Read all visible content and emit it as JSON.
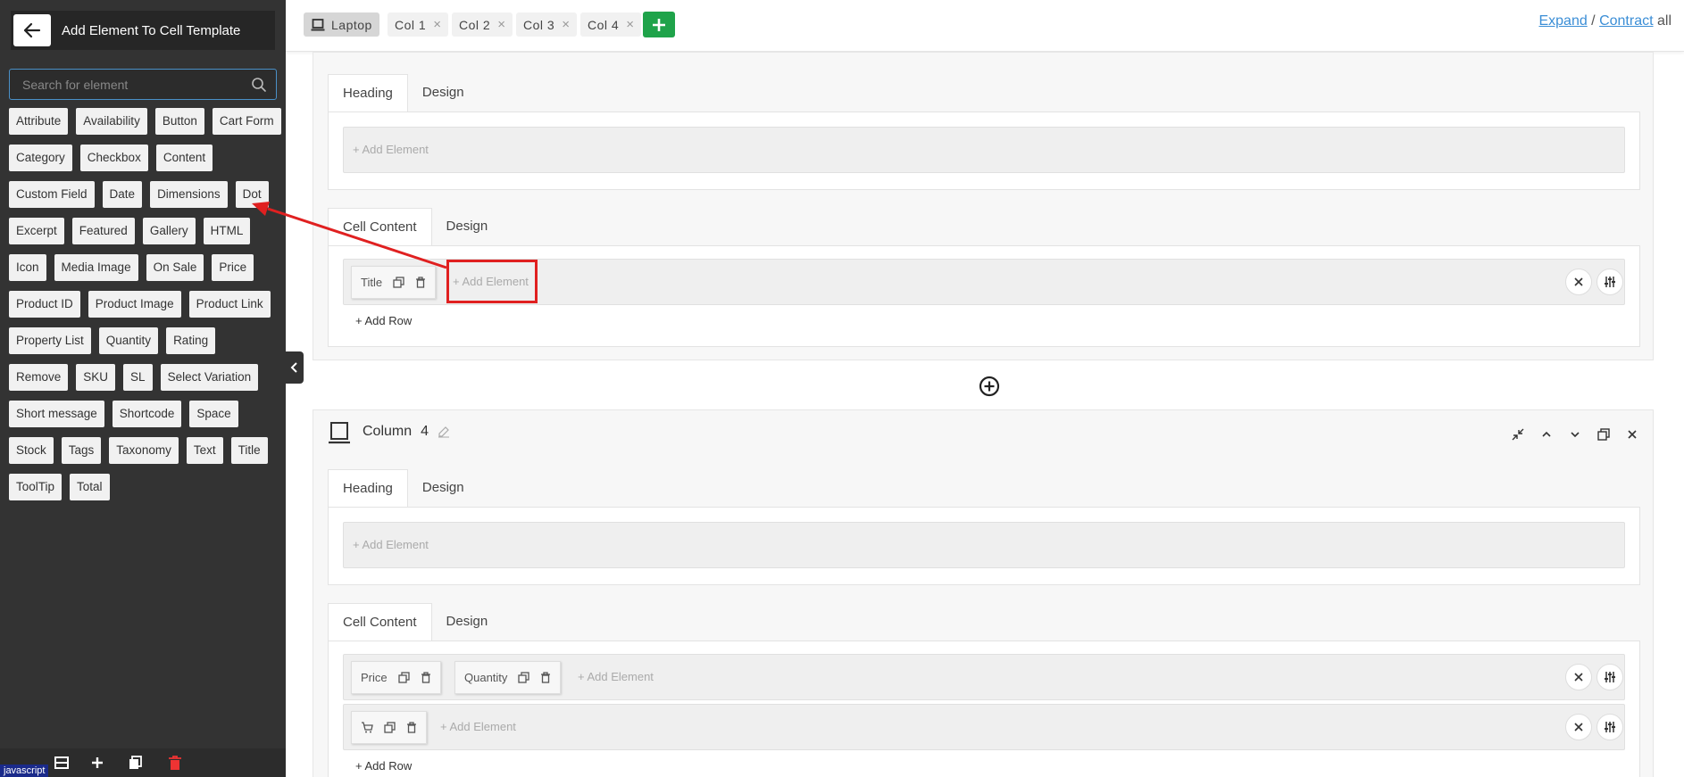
{
  "sidebar": {
    "title": "Add Element To Cell Template",
    "search_placeholder": "Search for element",
    "elements": [
      "Attribute",
      "Availability",
      "Button",
      "Cart Form",
      "Category",
      "Checkbox",
      "Content",
      "Custom Field",
      "Date",
      "Dimensions",
      "Dot",
      "Excerpt",
      "Featured",
      "Gallery",
      "HTML",
      "Icon",
      "Media Image",
      "On Sale",
      "Price",
      "Product ID",
      "Product Image",
      "Product Link",
      "Property List",
      "Quantity",
      "Rating",
      "Remove",
      "SKU",
      "SL",
      "Select Variation",
      "Short message",
      "Shortcode",
      "Space",
      "Stock",
      "Tags",
      "Taxonomy",
      "Text",
      "Title",
      "ToolTip",
      "Total"
    ],
    "footer_badge": "javascript"
  },
  "toolbar": {
    "device_tab": "Laptop",
    "col_tabs": [
      "Col 1",
      "Col 2",
      "Col 3",
      "Col 4"
    ],
    "close_glyph": "×",
    "expand": "Expand",
    "separator": " / ",
    "contract": "Contract",
    "all": " all"
  },
  "column3": {
    "heading_tab": "Heading",
    "design_tab": "Design",
    "heading_add": "+ Add Element",
    "cell_tab": "Cell Content",
    "cell_design_tab": "Design",
    "row1_elements": [
      "Title"
    ],
    "row1_add": "+ Add Element",
    "add_row": "+ Add Row"
  },
  "column4": {
    "title": "Column",
    "number": "4",
    "heading_tab": "Heading",
    "design_tab": "Design",
    "heading_add": "+ Add Element",
    "cell_tab": "Cell Content",
    "cell_design_tab": "Design",
    "row1_elements": [
      "Price",
      "Quantity"
    ],
    "row1_add": "+ Add Element",
    "row2_add": "+ Add Element",
    "add_row": "+ Add Row"
  },
  "colors": {
    "sidebar_bg": "#333333",
    "accent_green": "#1fa34a",
    "link_blue": "#3b8ed6",
    "highlight_red": "#e02020"
  }
}
